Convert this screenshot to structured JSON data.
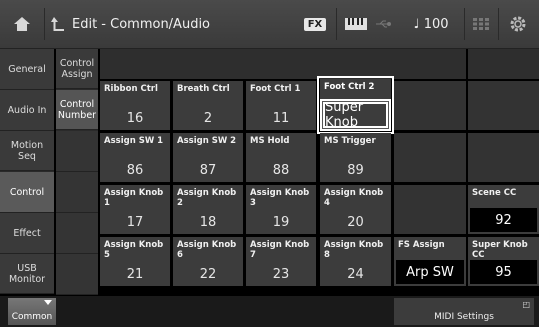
{
  "header": {
    "title": "Edit - Common/Audio",
    "fx_badge": "FX",
    "tempo": "♩ 100"
  },
  "sidebar": {
    "items": [
      {
        "label": "General"
      },
      {
        "label": "Audio In"
      },
      {
        "label": "Motion Seq"
      },
      {
        "label": "Control"
      },
      {
        "label": "Effect"
      },
      {
        "label": "USB Monitor"
      }
    ]
  },
  "subtabs": {
    "items": [
      {
        "label": "Control Assign"
      },
      {
        "label": "Control Number"
      }
    ]
  },
  "controls": [
    {
      "label": "Ribbon Ctrl",
      "value": "16"
    },
    {
      "label": "Breath Ctrl",
      "value": "2"
    },
    {
      "label": "Foot Ctrl 1",
      "value": "11"
    },
    {
      "label": "Foot Ctrl 2",
      "value": "Super Knob"
    },
    {
      "label": "Assign SW 1",
      "value": "86"
    },
    {
      "label": "Assign SW 2",
      "value": "87"
    },
    {
      "label": "MS Hold",
      "value": "88"
    },
    {
      "label": "MS Trigger",
      "value": "89"
    },
    {
      "label": "Assign Knob 1",
      "value": "17"
    },
    {
      "label": "Assign Knob 2",
      "value": "18"
    },
    {
      "label": "Assign Knob 3",
      "value": "19"
    },
    {
      "label": "Assign Knob 4",
      "value": "20"
    },
    {
      "label": "Scene CC",
      "value": "92"
    },
    {
      "label": "Assign Knob 5",
      "value": "21"
    },
    {
      "label": "Assign Knob 6",
      "value": "22"
    },
    {
      "label": "Assign Knob 7",
      "value": "23"
    },
    {
      "label": "Assign Knob 8",
      "value": "24"
    },
    {
      "label": "FS Assign",
      "value": "Arp SW"
    },
    {
      "label": "Super Knob CC",
      "value": "95"
    }
  ],
  "footer": {
    "common_label": "Common",
    "midi_settings_label": "MIDI Settings"
  },
  "icons": {
    "home": "home-icon",
    "back": "back-arrow-icon",
    "keyboard": "keyboard-icon",
    "usb": "usb-icon",
    "grid": "grid-icon",
    "gear": "gear-icon"
  }
}
